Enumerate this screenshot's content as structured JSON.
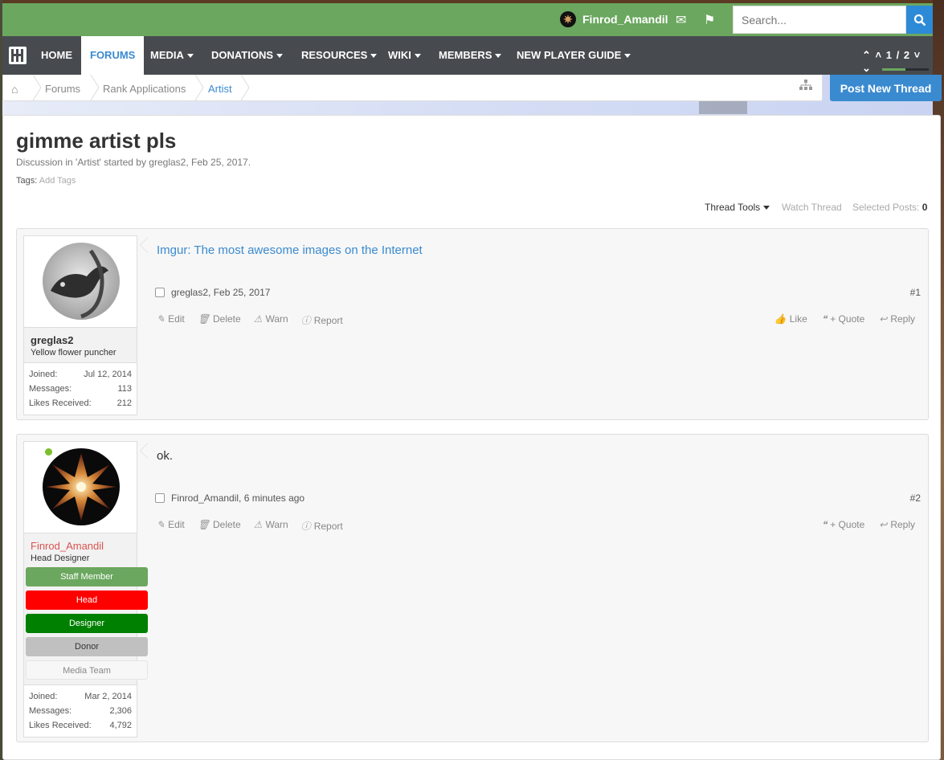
{
  "topbar": {
    "username": "Finrod_Amandil",
    "search_placeholder": "Search...",
    "icons": [
      "mail-icon",
      "flag-icon",
      "search-icon"
    ],
    "color": "#6ba75f"
  },
  "nav": {
    "items": [
      {
        "label": "HOME"
      },
      {
        "label": "FORUMS"
      },
      {
        "label": "MEDIA"
      },
      {
        "label": "DONATIONS"
      },
      {
        "label": "RESOURCES"
      },
      {
        "label": "WIKI"
      },
      {
        "label": "MEMBERS"
      },
      {
        "label": "NEW PLAYER GUIDE"
      }
    ],
    "pager": "1 / 2",
    "active_color": "#3a8ad0"
  },
  "breadcrumb": {
    "items": [
      "Forums",
      "Rank Applications",
      "Artist"
    ]
  },
  "post_new_thread": "Post New Thread",
  "thread": {
    "title": "gimme artist pls",
    "description": "Discussion in 'Artist' started by greglas2, Feb 25, 2017.",
    "tags_label": "Tags:",
    "tags_add": "Add Tags",
    "tools": {
      "thread_tools": "Thread Tools",
      "watch": "Watch Thread",
      "selected_label": "Selected Posts:",
      "selected_count": "0"
    }
  },
  "posts": [
    {
      "user": {
        "name": "greglas2",
        "title": "Yellow flower puncher",
        "joined_label": "Joined:",
        "joined": "Jul 12, 2014",
        "messages_label": "Messages:",
        "messages": "113",
        "likes_label": "Likes Received:",
        "likes": "212"
      },
      "link": "Imgur: The most awesome images on the Internet",
      "meta": "greglas2, Feb 25, 2017",
      "number": "#1",
      "actions": [
        "Edit",
        "Delete",
        "Warn",
        "Report"
      ],
      "right_actions": [
        "Like",
        "+ Quote",
        "Reply"
      ]
    },
    {
      "user": {
        "name": "Finrod_Amandil",
        "title": "Head Designer",
        "badges": [
          {
            "label": "Staff Member",
            "color": "#6ba75f",
            "text": "#fff"
          },
          {
            "label": "Head",
            "color": "#ff0000",
            "text": "#fff"
          },
          {
            "label": "Designer",
            "color": "#008000",
            "text": "#fff"
          },
          {
            "label": "Donor",
            "color": "#c0c0c0",
            "text": "#333"
          },
          {
            "label": "Media Team",
            "color": "#f7f7f7",
            "text": "#888"
          }
        ],
        "joined_label": "Joined:",
        "joined": "Mar 2, 2014",
        "messages_label": "Messages:",
        "messages": "2,306",
        "likes_label": "Likes Received:",
        "likes": "4,792"
      },
      "text": "ok.",
      "meta": "Finrod_Amandil, 6 minutes ago",
      "number": "#2",
      "actions": [
        "Edit",
        "Delete",
        "Warn",
        "Report"
      ],
      "right_actions": [
        "+ Quote",
        "Reply"
      ]
    }
  ]
}
